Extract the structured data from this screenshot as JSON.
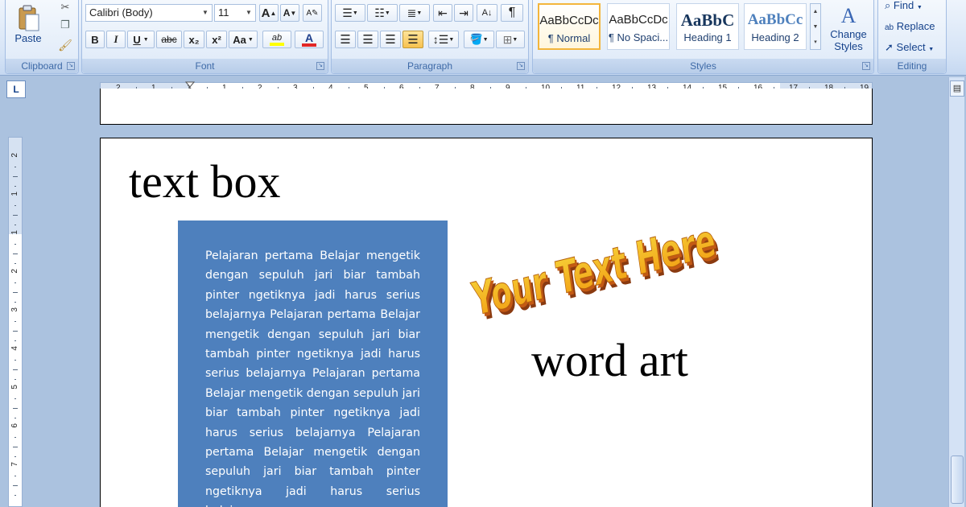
{
  "ribbon": {
    "clipboard": {
      "label": "Clipboard",
      "paste": "Paste"
    },
    "font": {
      "label": "Font",
      "family": "Calibri (Body)",
      "size": "11",
      "bold": "B",
      "italic": "I",
      "underline": "U",
      "strike": "abc",
      "subscript": "x₂",
      "superscript": "x²",
      "change_case": "Aa",
      "grow": "A",
      "shrink": "A",
      "font_color": "A",
      "highlight": "ab"
    },
    "paragraph": {
      "label": "Paragraph",
      "pilcrow": "¶"
    },
    "styles": {
      "label": "Styles",
      "tiles": [
        {
          "sample": "AaBbCcDc",
          "name": "¶ Normal"
        },
        {
          "sample": "AaBbCcDc",
          "name": "¶ No Spaci..."
        },
        {
          "sample": "AaBbC",
          "name": "Heading 1"
        },
        {
          "sample": "AaBbCc",
          "name": "Heading 2"
        }
      ],
      "change_styles": "Change Styles"
    },
    "editing": {
      "label": "Editing",
      "find": "Find",
      "replace": "Replace",
      "select": "Select"
    }
  },
  "ruler": {
    "corner": "L",
    "h_numbers": [
      "2",
      "1",
      "1",
      "1",
      "2",
      "3",
      "4",
      "5",
      "6",
      "7",
      "8",
      "9",
      "10",
      "11",
      "12",
      "13",
      "14",
      "15",
      "16",
      "17",
      "18",
      "19"
    ],
    "v_numbers": [
      "2",
      "1",
      "1",
      "2",
      "3",
      "4",
      "5",
      "6",
      "7"
    ]
  },
  "document": {
    "title_textbox": "text box",
    "caption_wordart": "word art",
    "wordart_text": "Your Text Here",
    "textbox_body": "Pelajaran pertama Belajar mengetik dengan sepuluh jari biar tambah pinter ngetiknya jadi harus serius belajarnya Pelajaran pertama Belajar mengetik dengan sepuluh jari biar tambah pinter ngetiknya jadi harus serius belajarnya Pelajaran pertama Belajar mengetik dengan sepuluh jari biar tambah pinter ngetiknya jadi harus serius belajarnya Pelajaran pertama Belajar mengetik dengan sepuluh jari biar tambah pinter ngetiknya jadi harus serius belajarnya"
  },
  "colors": {
    "ribbon_text": "#15428b",
    "textbox_fill": "#4e80bd",
    "wordart_orange": "#f29a10",
    "wordart_gold": "#f6d33a"
  }
}
